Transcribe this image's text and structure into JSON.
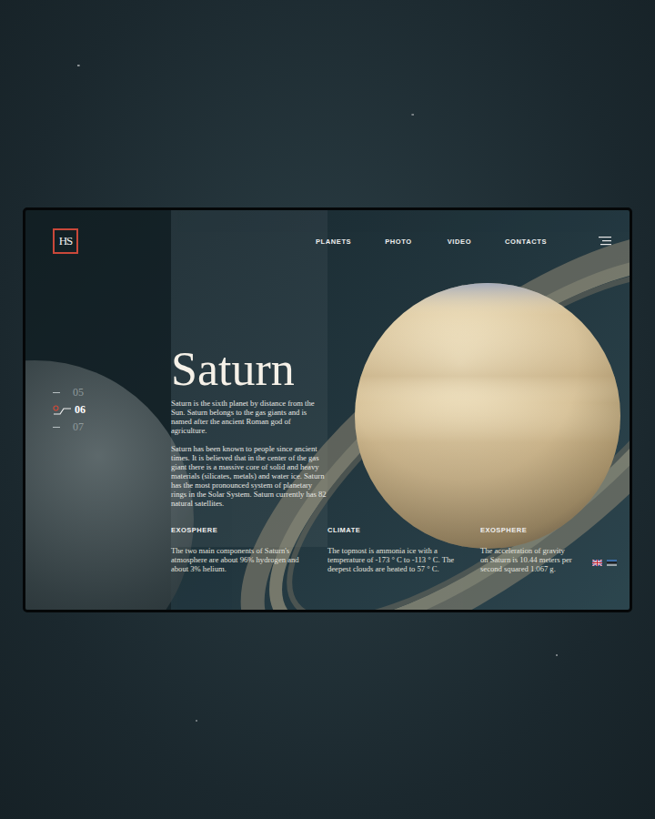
{
  "logo": {
    "text": "HS"
  },
  "nav": {
    "items": [
      {
        "label": "PLANETS"
      },
      {
        "label": "PHOTO"
      },
      {
        "label": "VIDEO"
      },
      {
        "label": "CONTACTS"
      }
    ]
  },
  "pager": [
    {
      "label": "05",
      "selected": false
    },
    {
      "label": "06",
      "selected": true
    },
    {
      "label": "07",
      "selected": false
    }
  ],
  "planet": {
    "title": "Saturn",
    "paragraphs": [
      "Saturn is the sixth planet by distance from the Sun. Saturn belongs to the gas giants and is named after the ancient Roman god of agriculture.",
      "Saturn has been known to people since ancient times. It is believed that in the center of the gas giant there is a massive core of solid and heavy materials (silicates, metals) and water ice. Saturn has the most pronounced system of planetary rings in the Solar System. Saturn currently has 82 natural satellites."
    ]
  },
  "facts": [
    {
      "heading": "EXOSPHERE",
      "text": "The two main components of Saturn's atmosphere are about 96% hydrogen and about 3% helium."
    },
    {
      "heading": "CLIMATE",
      "text": "The topmost is ammonia ice with a temperature of -173 ° C to -113 ° C. The deepest clouds are heated to 57 ° C."
    },
    {
      "heading": "EXOSPHERE",
      "text": "The acceleration of gravity on Saturn is 10.44 meters per second squared 1.067 g."
    }
  ]
}
